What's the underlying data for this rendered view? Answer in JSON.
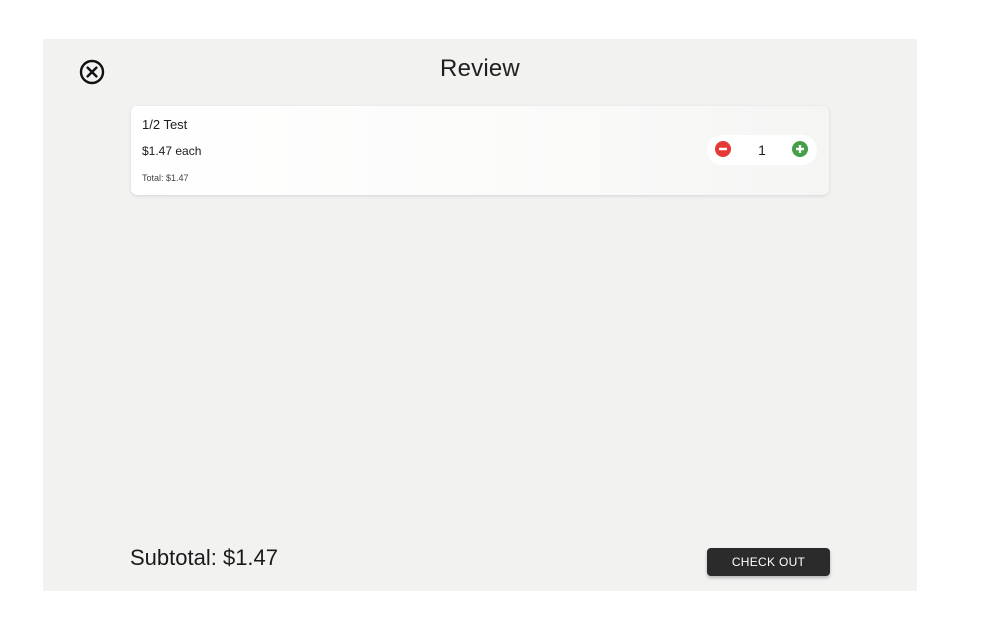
{
  "header": {
    "title": "Review",
    "close_icon": "circle-x-icon"
  },
  "cart": {
    "items": [
      {
        "name": "1/2 Test",
        "price": "$1.47 each",
        "total": "Total: $1.47",
        "quantity": "1"
      }
    ]
  },
  "footer": {
    "subtotal": "Subtotal: $1.47",
    "checkout_label": "CHECK OUT"
  },
  "colors": {
    "panel_bg": "#f2f2f1",
    "decrement": "#e53935",
    "increment": "#43a047",
    "checkout_bg": "#2b2b2b"
  }
}
